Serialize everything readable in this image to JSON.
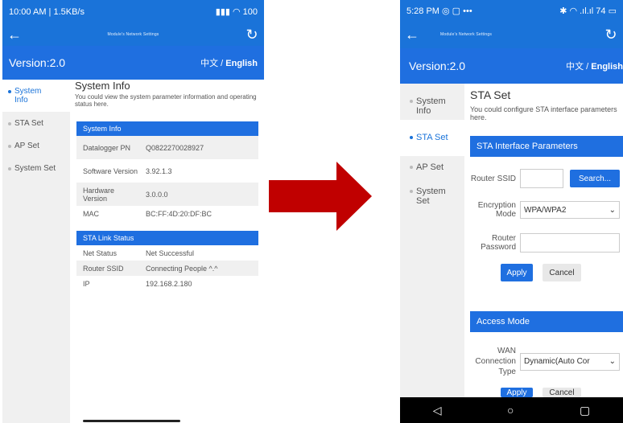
{
  "left_phone": {
    "status": {
      "time": "10:00 AM | 1.5KB/s",
      "battery": "100"
    },
    "appbar": {
      "back_icon": "arrow-left-icon",
      "title": "Module's Network Settings",
      "refresh_icon": "refresh-icon"
    },
    "version": "Version:2.0",
    "lang_zh": "中文",
    "lang_sep": "/",
    "lang_en": "English",
    "sidebar": [
      {
        "label": "System Info",
        "active": true
      },
      {
        "label": "STA Set",
        "active": false
      },
      {
        "label": "AP Set",
        "active": false
      },
      {
        "label": "System Set",
        "active": false
      }
    ],
    "page_title": "System Info",
    "page_desc": "You could view the system parameter information and operating status here.",
    "system_info": {
      "heading": "System Info",
      "rows": [
        {
          "label": "Datalogger PN",
          "value": "Q0822270028927"
        },
        {
          "label": "Software Version",
          "value": "3.92.1.3"
        },
        {
          "label": "Hardware Version",
          "value": "3.0.0.0"
        },
        {
          "label": "MAC",
          "value": "BC:FF:4D:20:DF:BC"
        }
      ]
    },
    "sta_link": {
      "heading": "STA Link Status",
      "rows": [
        {
          "label": "Net Status",
          "value": "Net Successful"
        },
        {
          "label": "Router SSID",
          "value": "Connecting People ^.^"
        },
        {
          "label": "IP",
          "value": "192.168.2.180"
        }
      ]
    }
  },
  "arrow": {
    "color": "#c00000"
  },
  "right_phone": {
    "status": {
      "time": "5:28 PM",
      "extra": "•••",
      "speed": "74"
    },
    "appbar": {
      "back_icon": "arrow-left-icon",
      "title": "Module's Network Settings",
      "refresh_icon": "refresh-icon"
    },
    "version": "Version:2.0",
    "lang_zh": "中文",
    "lang_sep": "/",
    "lang_en": "English",
    "sidebar": [
      {
        "label": "System Info",
        "active": false
      },
      {
        "label": "STA Set",
        "active": true
      },
      {
        "label": "AP Set",
        "active": false
      },
      {
        "label": "System Set",
        "active": false
      }
    ],
    "page_title": "STA Set",
    "page_desc": "You could configure STA interface parameters here.",
    "sta_params": {
      "heading": "STA Interface Parameters",
      "router_ssid_label": "Router SSID",
      "router_ssid_value": "",
      "search_button": "Search...",
      "encryption_label": "Encryption Mode",
      "encryption_value": "WPA/WPA2",
      "password_label": "Router Password",
      "password_value": "",
      "apply_button": "Apply",
      "cancel_button": "Cancel"
    },
    "access_mode": {
      "heading": "Access Mode",
      "wan_label": "WAN Connection Type",
      "wan_value": "Dynamic(Auto Cor",
      "apply_button": "Apply",
      "cancel_button": "Cancel"
    },
    "navbar": {
      "back": "◁",
      "home": "○",
      "recent": "▢"
    }
  },
  "colors": {
    "primary": "#1f6fe0",
    "sidebar_bg": "#f0f0f0",
    "arrow": "#c00000"
  }
}
